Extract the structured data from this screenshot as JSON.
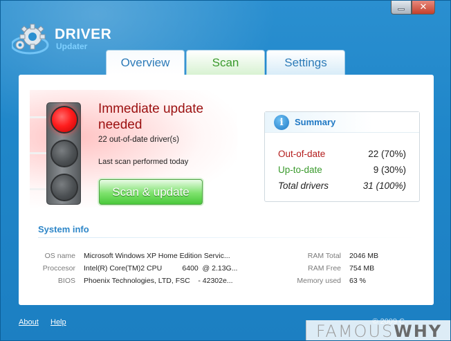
{
  "app": {
    "logo_line1": "DRIVER",
    "logo_line2": "Updater",
    "minimize_label": "",
    "close_label": "✕"
  },
  "tabs": [
    {
      "label": "Overview",
      "active": true
    },
    {
      "label": "Scan",
      "active": false
    },
    {
      "label": "Settings",
      "active": false
    }
  ],
  "status": {
    "title": "Immediate update needed",
    "count_text": "22 out-of-date driver(s)",
    "last_scan": "Last scan performed today",
    "scan_button": "Scan & update",
    "light_active": "red"
  },
  "summary": {
    "title": "Summary",
    "info_icon": "i",
    "rows": [
      {
        "label": "Out-of-date",
        "value": "22 (70%)"
      },
      {
        "label": "Up-to-date",
        "value": "9 (30%)"
      },
      {
        "label": "Total drivers",
        "value": "31 (100%)"
      }
    ]
  },
  "system_info": {
    "title": "System info",
    "os_label": "OS name",
    "os_value": "Microsoft Windows XP Home Edition Servic...",
    "cpu_label": "Proccesor",
    "cpu_value": "Intel(R) Core(TM)2 CPU          6400  @ 2.13G...",
    "bios_label": "BIOS",
    "bios_value": "Phoenix Technologies, LTD, FSC    - 42302e...",
    "ram_total_label": "RAM Total",
    "ram_total_value": "2046 MB",
    "ram_free_label": "RAM Free",
    "ram_free_value": "754 MB",
    "mem_used_label": "Memory used",
    "mem_used_value": "63 %"
  },
  "footer": {
    "about": "About",
    "help": "Help",
    "copyright": "© 2009 C"
  },
  "watermark": {
    "part1": "FAMOUS",
    "part2": "WHY"
  },
  "colors": {
    "frame_blue": "#1f86c9",
    "alert_red": "#9b1010",
    "ok_green": "#3a9a2c",
    "accent_blue": "#2d86c8"
  }
}
